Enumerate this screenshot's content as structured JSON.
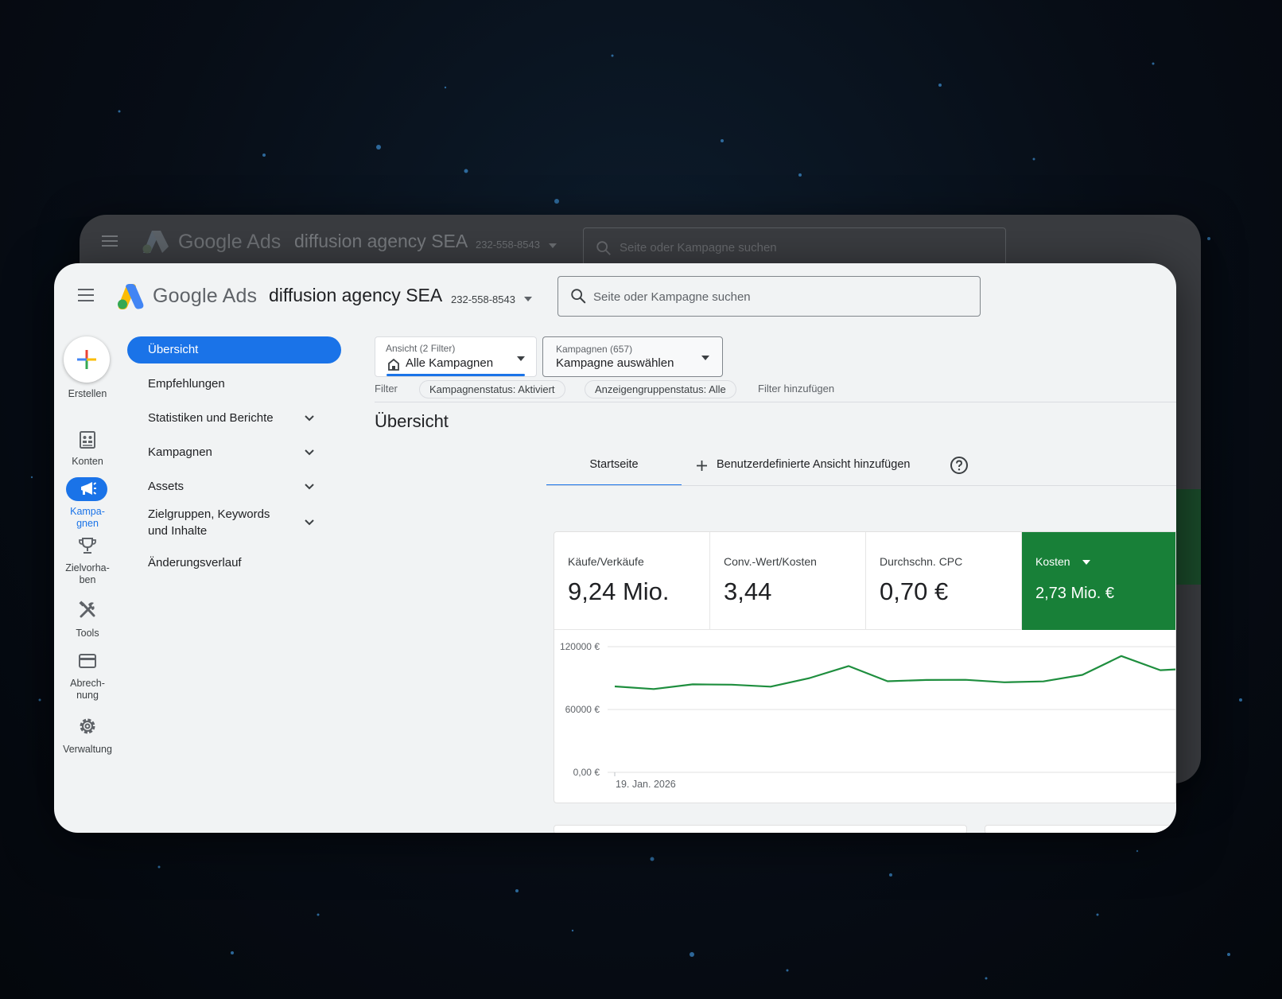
{
  "header": {
    "brand": "Google Ads",
    "account_name": "diffusion agency SEA",
    "account_id": "232-558-8543",
    "search_placeholder": "Seite oder Kampagne suchen"
  },
  "rail": {
    "create_label": "Erstellen",
    "items": [
      {
        "label": "Konten",
        "icon": "accounts-icon"
      },
      {
        "label": "Kampa-\ngnen",
        "icon": "campaigns-icon",
        "active": true
      },
      {
        "label": "Zielvorha-\nben",
        "icon": "trophy-icon"
      },
      {
        "label": "Tools",
        "icon": "tools-icon"
      },
      {
        "label": "Abrech-\nnung",
        "icon": "credit-card-icon"
      },
      {
        "label": "Verwaltung",
        "icon": "gear-icon"
      }
    ]
  },
  "nav": {
    "items": [
      {
        "label": "Übersicht",
        "active": true
      },
      {
        "label": "Empfehlungen"
      },
      {
        "label": "Statistiken und Berichte",
        "expandable": true
      },
      {
        "label": "Kampagnen",
        "expandable": true
      },
      {
        "label": "Assets",
        "expandable": true
      },
      {
        "label": "Zielgruppen, Keywords\nund Inhalte",
        "expandable": true
      },
      {
        "label": "Änderungsverlauf"
      }
    ]
  },
  "filters": {
    "view_caption": "Ansicht (2 Filter)",
    "view_value": "Alle Kampagnen",
    "campaign_caption": "Kampagnen (657)",
    "campaign_value": "Kampagne auswählen",
    "filter_label": "Filter",
    "chips": [
      "Kampagnenstatus: Aktiviert",
      "Anzeigengruppenstatus: Alle"
    ],
    "add_filter": "Filter hinzufügen"
  },
  "page": {
    "title": "Übersicht",
    "tab_home": "Startseite",
    "tab_add": "Benutzerdefinierte Ansicht hinzufügen"
  },
  "metrics": [
    {
      "label": "Käufe/Verkäufe",
      "value": "9,24 Mio."
    },
    {
      "label": "Conv.-Wert/Kosten",
      "value": "3,44"
    },
    {
      "label": "Durchschn. CPC",
      "value": "0,70 €"
    },
    {
      "label": "Kosten",
      "value": "2,73 Mio. €",
      "active": true
    }
  ],
  "colors": {
    "accent_blue": "#1a73e8",
    "cost_green": "#188038",
    "line_green": "#1e8e3e"
  },
  "chart_data": {
    "type": "line",
    "x_start_label": "19. Jan. 2026",
    "y_ticks": [
      "120000 €",
      "60000 €",
      "0,00 €"
    ],
    "ylim": [
      0,
      120000
    ],
    "series": [
      {
        "values": [
          82000,
          79500,
          84000,
          83700,
          81800,
          90000,
          101500,
          87000,
          88200,
          88300,
          86000,
          86800,
          93000,
          111000,
          97500,
          99500
        ]
      }
    ]
  }
}
